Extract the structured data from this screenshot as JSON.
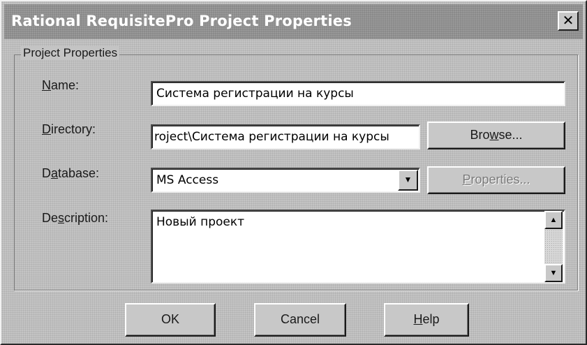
{
  "window": {
    "title": "Rational RequisitePro Project Properties"
  },
  "icons": {
    "close": "close-icon",
    "dropdown": "chevron-down-icon",
    "scroll_up": "arrow-up-icon",
    "scroll_down": "arrow-down-icon"
  },
  "group": {
    "label": "Project Properties"
  },
  "fields": {
    "name": {
      "label_prefix": "",
      "label_accel": "N",
      "label_rest": "ame:",
      "value": "Система регистрации на курсы"
    },
    "directory": {
      "label_prefix": "",
      "label_accel": "D",
      "label_rest": "irectory:",
      "value": "roject\\Система регистрации на курсы"
    },
    "database": {
      "label_prefix": "D",
      "label_accel": "a",
      "label_rest": "tabase:",
      "value": "MS Access"
    },
    "description": {
      "label_prefix": "De",
      "label_accel": "s",
      "label_rest": "cription:",
      "value": "Новый проект"
    }
  },
  "buttons": {
    "browse": {
      "prefix": "Bro",
      "accel": "w",
      "rest": "se..."
    },
    "properties": {
      "prefix": "",
      "accel": "P",
      "rest": "roperties..."
    },
    "ok": {
      "label": "OK"
    },
    "cancel": {
      "label": "Cancel"
    },
    "help": {
      "prefix": "",
      "accel": "H",
      "rest": "elp"
    }
  }
}
